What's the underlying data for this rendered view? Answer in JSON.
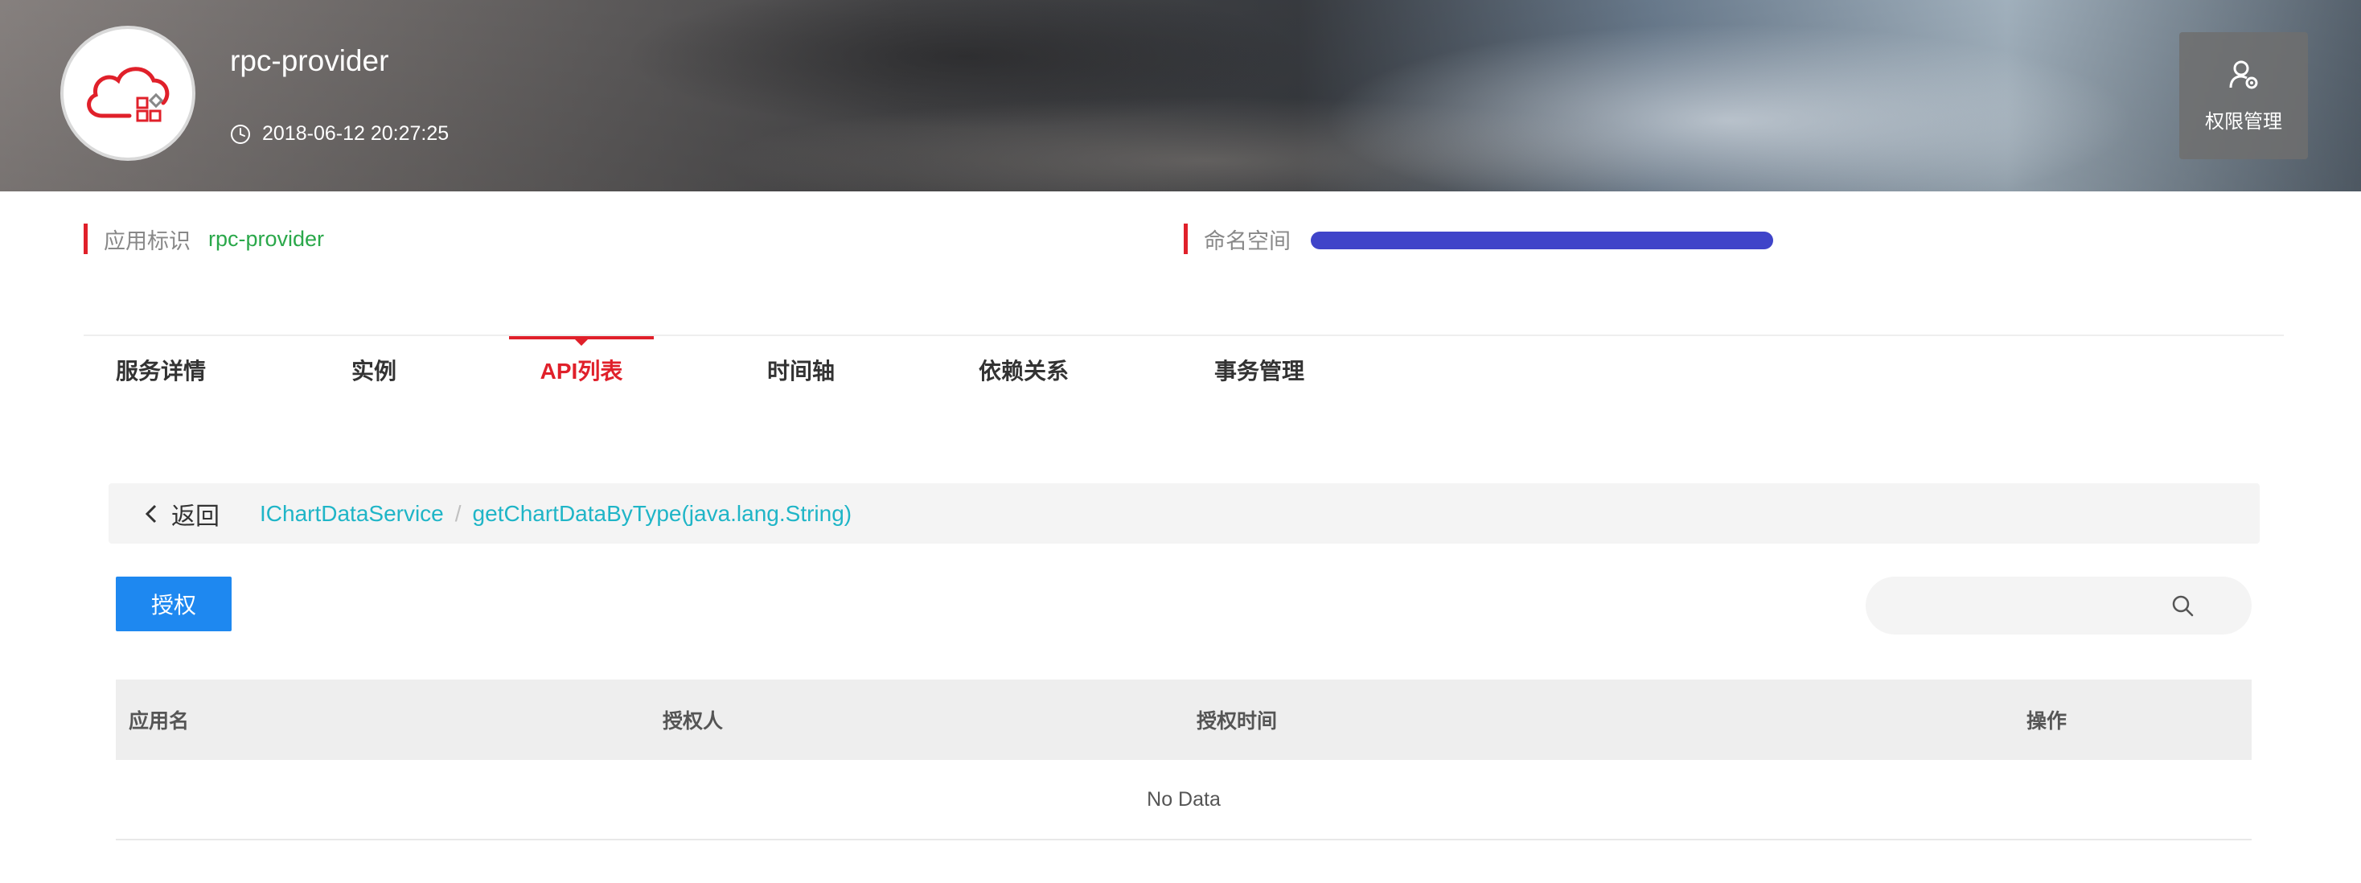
{
  "header": {
    "app_name": "rpc-provider",
    "created_time": "2018-06-12 20:27:25",
    "permission_button": "权限管理"
  },
  "info": {
    "app_id_label": "应用标识",
    "app_id_value": "rpc-provider",
    "namespace_label": "命名空间"
  },
  "tabs": [
    {
      "label": "服务详情"
    },
    {
      "label": "实例"
    },
    {
      "label": "API列表"
    },
    {
      "label": "时间轴"
    },
    {
      "label": "依赖关系"
    },
    {
      "label": "事务管理"
    }
  ],
  "breadcrumb": {
    "back_label": "返回",
    "items": [
      "IChartDataService",
      "getChartDataByType(java.lang.String)"
    ],
    "separator": "/"
  },
  "toolbar": {
    "authorize_label": "授权",
    "search_placeholder": ""
  },
  "table": {
    "columns": [
      "应用名",
      "授权人",
      "授权时间",
      "操作"
    ],
    "empty_text": "No Data"
  },
  "colors": {
    "accent_red": "#e0202a",
    "primary_blue": "#1e88f0",
    "link_cyan": "#1fb5c7",
    "value_green": "#2aa84a"
  }
}
